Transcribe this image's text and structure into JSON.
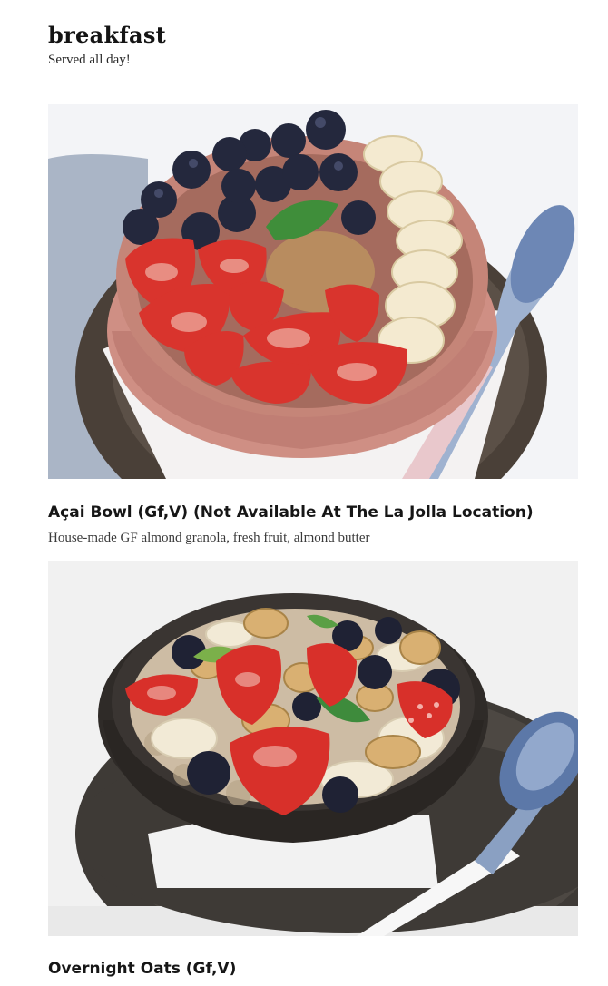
{
  "section": {
    "title": "breakfast",
    "subtitle": "Served all day!"
  },
  "items": [
    {
      "name": "Açai Bowl (Gf,V) (Not Available At The La Jolla Location)",
      "description": "House-made GF almond granola, fresh fruit, almond butter",
      "image_icon": "acai-bowl-photo"
    },
    {
      "name": "Overnight Oats (Gf,V)",
      "image_icon": "overnight-oats-photo"
    }
  ]
}
